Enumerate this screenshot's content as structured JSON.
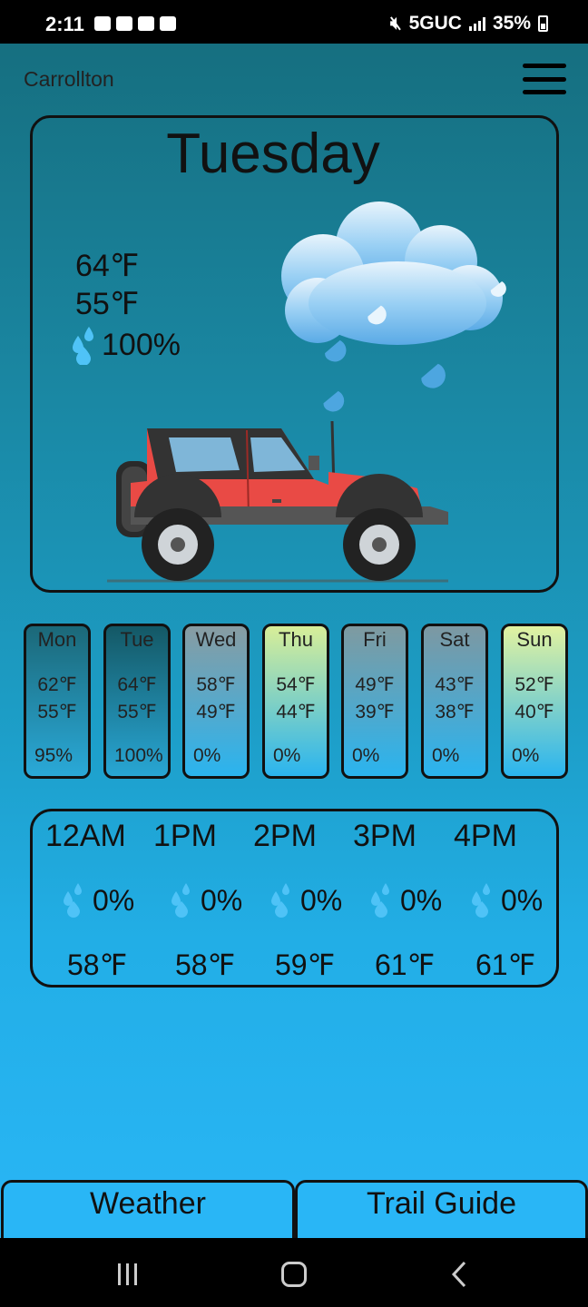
{
  "status": {
    "time": "2:11",
    "network": "5GUC",
    "battery": "35%",
    "left_icons": [
      "message-icon",
      "youtube-icon",
      "mail-icon",
      "image-icon"
    ],
    "right_icons": [
      "mute-icon",
      "signal-icon",
      "battery-icon"
    ]
  },
  "header": {
    "location": "Carrollton",
    "menu_icon": "hamburger-menu-icon"
  },
  "today": {
    "day": "Tuesday",
    "high": "64℉",
    "low": "55℉",
    "rain": "100%",
    "weather_icon": "rain-cloud-icon",
    "illustration": "red-jeep-illustration"
  },
  "forecast": [
    {
      "day": "Mon",
      "high": "62℉",
      "low": "55℉",
      "rain": "95%",
      "top": "#1b6878",
      "bottom": "#2aa9d8"
    },
    {
      "day": "Tue",
      "high": "64℉",
      "low": "55℉",
      "rain": "100%",
      "top": "#145865",
      "bottom": "#28a6d4"
    },
    {
      "day": "Wed",
      "high": "58℉",
      "low": "49℉",
      "rain": "0%",
      "top": "#889ca2",
      "bottom": "#2ab4ef"
    },
    {
      "day": "Thu",
      "high": "54℉",
      "low": "44℉",
      "rain": "0%",
      "top": "#d8ee98",
      "bottom": "#2ab4ef"
    },
    {
      "day": "Fri",
      "high": "49℉",
      "low": "39℉",
      "rain": "0%",
      "top": "#7f9aa0",
      "bottom": "#2ab4ef"
    },
    {
      "day": "Sat",
      "high": "43℉",
      "low": "38℉",
      "rain": "0%",
      "top": "#7d98a2",
      "bottom": "#2ab4ef"
    },
    {
      "day": "Sun",
      "high": "52℉",
      "low": "40℉",
      "rain": "0%",
      "top": "#e2f2a0",
      "bottom": "#2ab4ef"
    }
  ],
  "hourly": [
    {
      "time": "12AM",
      "rain": "0%",
      "temp": "58℉"
    },
    {
      "time": "1PM",
      "rain": "0%",
      "temp": "58℉"
    },
    {
      "time": "2PM",
      "rain": "0%",
      "temp": "59℉"
    },
    {
      "time": "3PM",
      "rain": "0%",
      "temp": "61℉"
    },
    {
      "time": "4PM",
      "rain": "0%",
      "temp": "61℉"
    }
  ],
  "tabs": {
    "weather": "Weather",
    "trail_guide": "Trail Guide"
  },
  "colors": {
    "accent": "#29b6f6",
    "drop": "#4fc3f7",
    "jeep_body": "#f0504a"
  }
}
